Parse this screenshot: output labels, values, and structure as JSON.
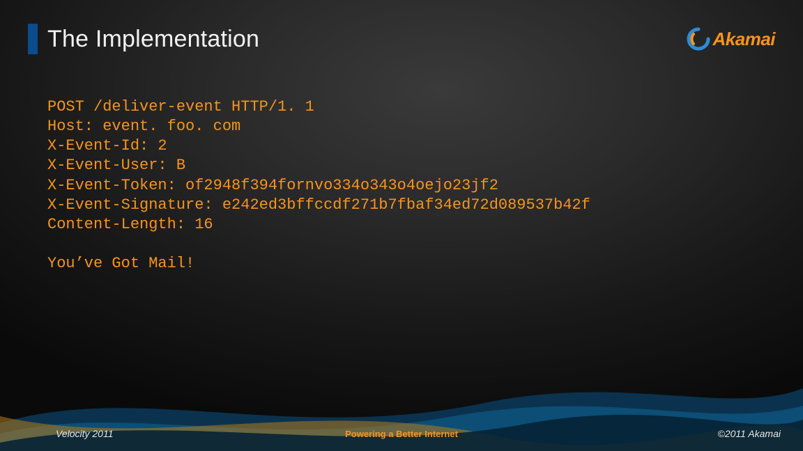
{
  "header": {
    "title": "The Implementation",
    "logo_text": "Akamai"
  },
  "code": {
    "lines": [
      "POST /deliver-event HTTP/1. 1",
      "Host: event. foo. com",
      "X-Event-Id: 2",
      "X-Event-User: B",
      "X-Event-Token: of2948f394fornvo334o343o4oejo23jf2",
      "X-Event-Signature: e242ed3bffccdf271b7fbaf34ed72d089537b42f",
      "Content-Length: 16",
      "",
      "You’ve Got Mail!"
    ]
  },
  "footer": {
    "left": "Velocity 2011",
    "center": "Powering a Better Internet",
    "right": "©2011 Akamai"
  },
  "colors": {
    "accent": "#f7941d",
    "bar": "#0b4c8c"
  }
}
